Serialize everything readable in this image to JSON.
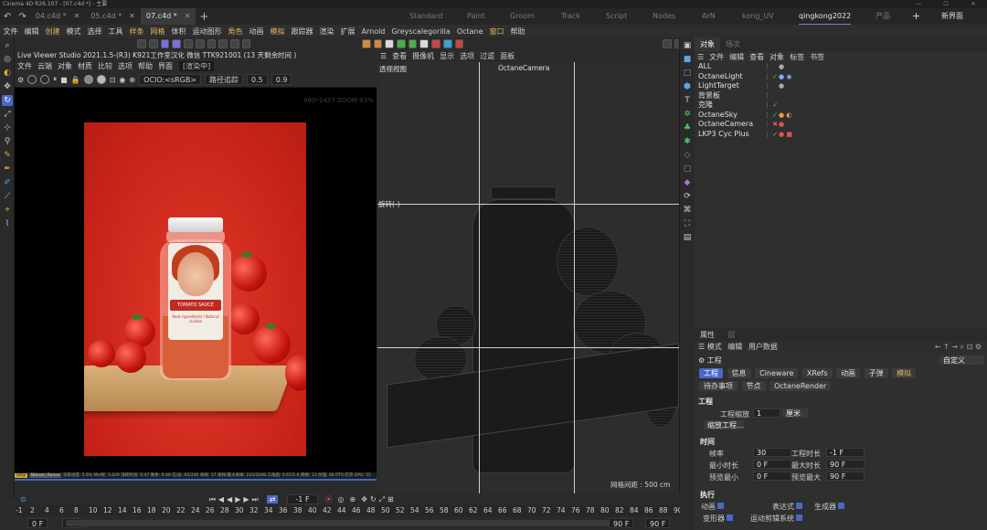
{
  "title_bar": {
    "text": "Cinema 4D R26.107 - [07.c4d *] - 主要",
    "minimize": "—",
    "maximize": "☐",
    "close": "✕"
  },
  "tabs": [
    {
      "label": "04.c4d *"
    },
    {
      "label": "05.c4d *"
    },
    {
      "label": "07.c4d *"
    }
  ],
  "layouts": [
    "Standard",
    "Paint",
    "Groom",
    "Track",
    "Script",
    "Nodes",
    "ArN",
    "kong_UV",
    "qingkong2022",
    "产品"
  ],
  "new_interface": "新界面",
  "menu": [
    "文件",
    "编辑",
    "创建",
    "模式",
    "选择",
    "工具",
    "样条",
    "网格",
    "体积",
    "运动图形",
    "角色",
    "动画",
    "模拟",
    "跟踪器",
    "渲染",
    "扩展",
    "Arnold",
    "Greyscalegorilla",
    "Octane",
    "窗口",
    "帮助"
  ],
  "live_viewer": {
    "title": "Live Viewer Studio 2021.1.5-(R3)  K921工作室汉化 微信  TTK921001 (13 天剩余时间 )",
    "menu": [
      "文件",
      "云端",
      "对象",
      "材质",
      "比较",
      "选项",
      "帮助",
      "界面"
    ],
    "render_state": "[渲染中]",
    "ocio": "OCIO:<sRGB>",
    "path_trace": "路径追踪",
    "value_a": "0.5",
    "value_b": "0.9",
    "overlay": "960*1437 ZOOM:93%",
    "jar_banner": "TOMATO SAUCE",
    "jar_subtitle": "Real ingredients / Natural cuisine",
    "status": {
      "tag": "Stop",
      "tag2": "Ntkner: Rense",
      "metrics": "渲染进度: 5.6%  Ms/帧: 3.429  消耗时间: 0:47  剩余: 0:49  已/总: 65/240  采样: 17  采样/最大采样: 233/2048  三角面: 0.67/1.6  网格: 13  纹理: 84  RTX:打开  GPU: 55"
    }
  },
  "viewport": {
    "menu": [
      "查看",
      "摄像机",
      "显示",
      "选项",
      "过滤",
      "面板"
    ],
    "label": "透视视图",
    "camera": "OctaneCamera",
    "rotation_label": "旋转(-)",
    "grid_spacing": "网格间距 : 500 cm"
  },
  "objects_panel": {
    "tabs": [
      "对象",
      "场次"
    ],
    "menu": [
      "文件",
      "编辑",
      "查看",
      "对象",
      "标签",
      "书签"
    ],
    "items": [
      {
        "name": "ALL",
        "flags": "⋮",
        "tags": "●"
      },
      {
        "name": "OctaneLight",
        "flags": "⋮ ✓",
        "tags": "● ◉"
      },
      {
        "name": "LightTarget",
        "flags": "⋮",
        "tags": "●"
      },
      {
        "name": "背景板",
        "flags": "⋮",
        "tags": ""
      },
      {
        "name": "克隆",
        "flags": "⋮ ✓",
        "tags": ""
      },
      {
        "name": "OctaneSky",
        "flags": "⋮ ✓",
        "tags": "● ◐"
      },
      {
        "name": "OctaneCamera",
        "flags": "⋮ ✖",
        "tags": "●"
      },
      {
        "name": "LKP3 Cyc Plus",
        "flags": "⋮ ✓",
        "tags": "● ■"
      }
    ]
  },
  "attributes_panel": {
    "tabs": [
      "属性",
      "层"
    ],
    "menu": [
      "模式",
      "编辑",
      "用户数据"
    ],
    "heading": "工程",
    "preset": "自定义",
    "chips_row1": [
      "工程",
      "信息",
      "Cineware",
      "XRefs",
      "动画",
      "子弹",
      "模拟"
    ],
    "chips_row2": [
      "待办事项",
      "节点",
      "OctaneRender"
    ],
    "section_project": "工程",
    "project_scale_label": "工程缩放",
    "project_scale_value": "1",
    "project_scale_unit": "厘米",
    "scale_project_button": "缩放工程...",
    "section_time": "时间",
    "fps_label": "帧率",
    "fps_value": "30",
    "project_time_label": "工程时长",
    "project_time_value": "-1 F",
    "min_time_label": "最小时长",
    "min_time_value": "0 F",
    "max_time_label": "最大时长",
    "max_time_value": "90 F",
    "preview_min_label": "预览最小",
    "preview_min_value": "0 F",
    "preview_max_label": "预览最大",
    "preview_max_value": "90 F",
    "section_exec": "执行",
    "exec_items": [
      "动画",
      "表达式",
      "生成器",
      "变形器",
      "运动剪辑系统"
    ]
  },
  "timeline": {
    "current_frame": "-1 F",
    "ruler": [
      "-1",
      "2",
      "4",
      "6",
      "8",
      "10",
      "12",
      "14",
      "16",
      "18",
      "20",
      "22",
      "24",
      "26",
      "28",
      "30",
      "32",
      "34",
      "36",
      "38",
      "40",
      "42",
      "44",
      "46",
      "48",
      "50",
      "52",
      "54",
      "56",
      "58",
      "60",
      "62",
      "64",
      "66",
      "68",
      "70",
      "72",
      "74",
      "76",
      "78",
      "80",
      "82",
      "84",
      "86",
      "88",
      "90"
    ],
    "start_a": "0 F",
    "start_b": "0 F",
    "end_a": "90 F",
    "end_b": "90 F"
  },
  "colors": {
    "accent": "#4a68c8",
    "highlight_menu": "#e3b35c",
    "render_bg": "#c92418"
  }
}
